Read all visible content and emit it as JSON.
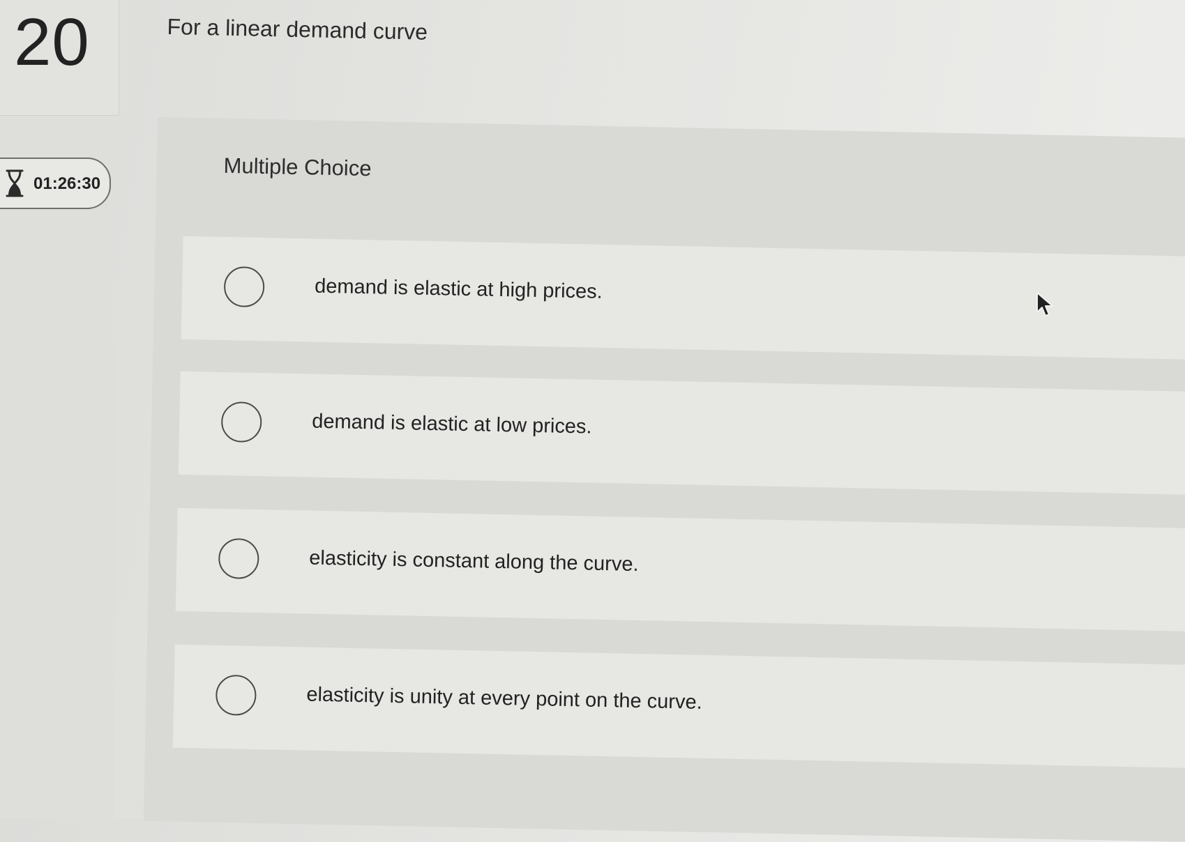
{
  "question": {
    "number": "20",
    "text": "For a linear demand curve"
  },
  "timer": {
    "icon": "hourglass-icon",
    "value": "01:26:30"
  },
  "choices": {
    "label": "Multiple Choice",
    "options": [
      {
        "text": "demand is elastic at high prices."
      },
      {
        "text": "demand is elastic at low prices."
      },
      {
        "text": "elasticity is constant along the curve."
      },
      {
        "text": "elasticity is unity at every point on the curve."
      }
    ]
  },
  "colors": {
    "background": "#e4e4e1",
    "panel": "#d9d9d6",
    "option_card": "#e7e7e4",
    "text": "#222222"
  }
}
